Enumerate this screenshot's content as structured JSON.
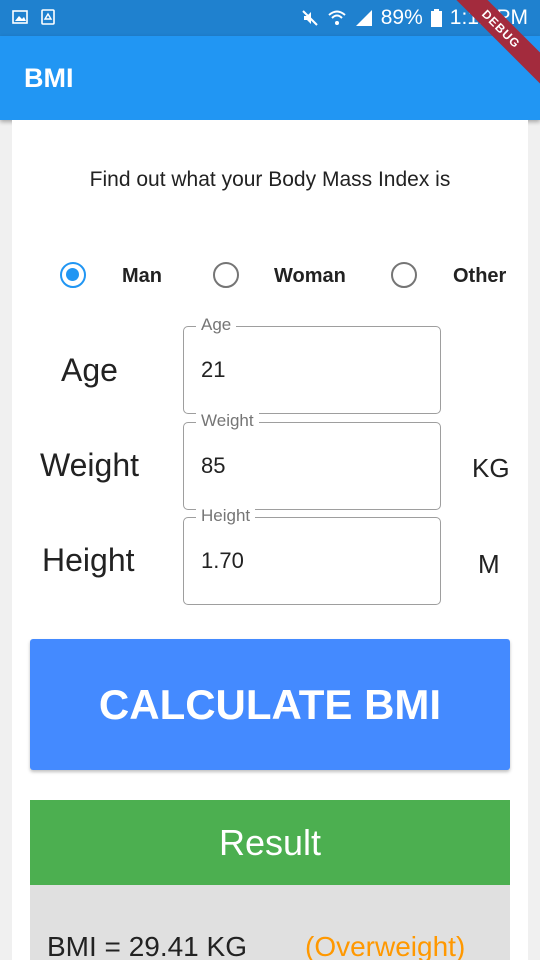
{
  "status_bar": {
    "battery": "89%",
    "time": "1:12 PM",
    "icons": [
      "image-icon",
      "recycle-icon",
      "mute-icon",
      "wifi-icon",
      "signal-icon",
      "battery-icon"
    ]
  },
  "debug_banner": "DEBUG",
  "app_bar": {
    "title": "BMI"
  },
  "subtitle": "Find out what your Body Mass Index is",
  "gender": {
    "selected": "Man",
    "options": [
      "Man",
      "Woman",
      "Other"
    ]
  },
  "fields": {
    "age": {
      "row_label": "Age",
      "label": "Age",
      "value": "21",
      "unit": ""
    },
    "weight": {
      "row_label": "Weight",
      "label": "Weight",
      "value": "85",
      "unit": "KG"
    },
    "height": {
      "row_label": "Height",
      "label": "Height",
      "value": "1.70",
      "unit": "M"
    }
  },
  "calculate_button": "CALCULATE BMI",
  "result": {
    "header": "Result",
    "bmi_text": "BMI = 29.41 KG",
    "category": "(Overweight)"
  },
  "colors": {
    "status_bar": "#1f81cf",
    "app_bar": "#2196f3",
    "radio_checked": "#2196f3",
    "button": "#448aff",
    "result_header": "#4caf50",
    "category": "#ff9800"
  }
}
